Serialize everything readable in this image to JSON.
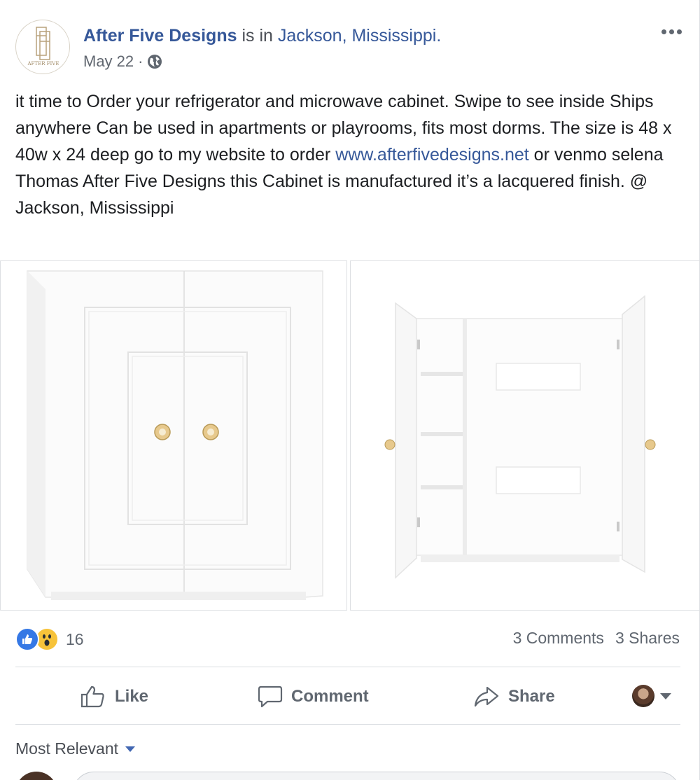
{
  "post": {
    "author": "After Five Designs",
    "connector": " is in ",
    "location": "Jackson, Mississippi.",
    "date": "May 22",
    "separator": "·",
    "privacy_icon": "globe-icon",
    "logo_text": "AFTER FIVE",
    "text_part1": "it time to Order your refrigerator and microwave cabinet. Swipe to see inside Ships anywhere Can be used in apartments or playrooms, fits most dorms. The size is 48 x 40w x 24 deep go to my website to order ",
    "link": "www.afterfivedesigns.net",
    "text_part2": " or venmo selena Thomas After Five Designs this Cabinet is manufactured it’s a lacquered finish. @ Jackson, Mississippi"
  },
  "photos": [
    {
      "icon": "closed-cabinet-photo"
    },
    {
      "icon": "open-cabinet-photo"
    }
  ],
  "reactions": {
    "icons": [
      "like-reaction-icon",
      "wow-reaction-icon"
    ],
    "count": "16",
    "comments": "3 Comments",
    "shares": "3 Shares"
  },
  "actions": {
    "like": "Like",
    "comment": "Comment",
    "share": "Share"
  },
  "comments": {
    "sort_label": "Most Relevant"
  },
  "colors": {
    "link": "#365899",
    "like_blue": "#3578e5",
    "wow_yellow": "#f7c33a",
    "muted": "#606770"
  }
}
